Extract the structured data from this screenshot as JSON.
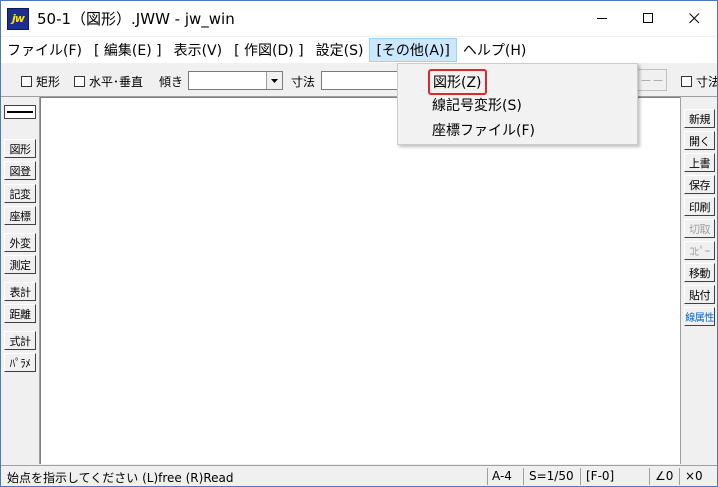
{
  "window": {
    "title": "50-1（図形）.JWW - jw_win",
    "icon_text": "jw",
    "minimize_icon": "minimize-icon",
    "maximize_icon": "maximize-icon",
    "close_icon": "close-icon"
  },
  "menubar": {
    "items": [
      {
        "label": "ファイル(F)"
      },
      {
        "label": "[ 編集(E) ]"
      },
      {
        "label": "表示(V)"
      },
      {
        "label": "[ 作図(D) ]"
      },
      {
        "label": "設定(S)"
      },
      {
        "label": "[その他(A)]"
      },
      {
        "label": "ヘルプ(H)"
      }
    ],
    "active_index": 5
  },
  "toolbar": {
    "rect_label": "矩形",
    "horiz_vert_label": "水平･垂直",
    "tilt_label": "傾き",
    "tilt_value": "",
    "dimension_label": "寸法",
    "dimension_value": "",
    "dash_button_label": "－－",
    "right_dimension_label": "寸法"
  },
  "dropdown": {
    "items": [
      {
        "label": "図形(Z)"
      },
      {
        "label": "線記号変形(S)"
      },
      {
        "label": "座標ファイル(F)"
      }
    ],
    "highlighted_index": 0,
    "highlight_color": "#e0262a"
  },
  "left_panel": {
    "buttons": [
      "図形",
      "図登",
      "記変",
      "座標",
      "外変",
      "測定",
      "表計",
      "距離",
      "式計",
      "ﾊﾟﾗﾒ"
    ]
  },
  "right_panel": {
    "buttons": [
      "新規",
      "開く",
      "上書",
      "保存",
      "印刷",
      "切取",
      "ｺﾋﾟｰ",
      "移動",
      "貼付",
      "線属性"
    ],
    "disabled": [
      5,
      6
    ],
    "accent": [
      9
    ],
    "accent_color": "#0066cc"
  },
  "statusbar": {
    "message": "始点を指示してください (L)free (R)Read",
    "paper": "A-4",
    "scale": "S=1/50",
    "layer": "[F-0]",
    "angle": "∠0",
    "zoom": "×0"
  }
}
